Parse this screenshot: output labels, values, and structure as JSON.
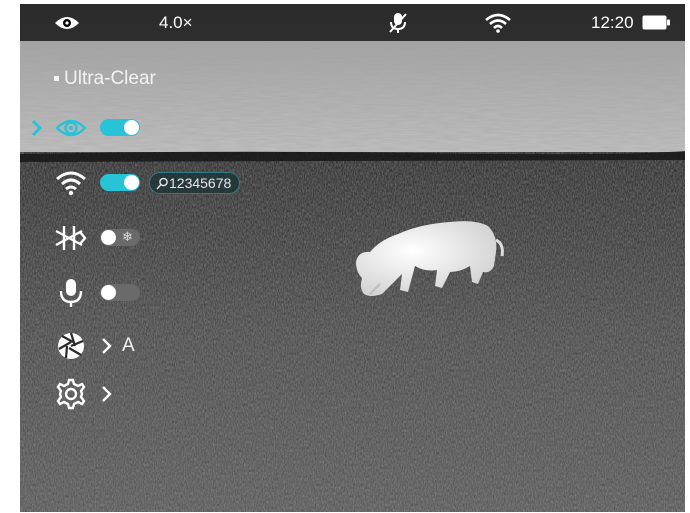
{
  "status_bar": {
    "view_mode_icon": "eye-icon",
    "zoom": "4.0×",
    "mic_icon": "mic-muted-icon",
    "wifi_icon": "wifi-icon",
    "time": "12:20",
    "battery_icon": "battery-icon"
  },
  "menu": {
    "title": "Ultra-Clear",
    "items": [
      {
        "icon": "eye-icon",
        "type": "toggle",
        "state": "on",
        "selected": true
      },
      {
        "icon": "wifi-icon",
        "type": "toggle",
        "state": "on",
        "ssid": "12345678",
        "ssid_icon": "key-icon"
      },
      {
        "icon": "snowflake-icon",
        "type": "toggle",
        "state": "off"
      },
      {
        "icon": "microphone-icon",
        "type": "toggle",
        "state": "off"
      },
      {
        "icon": "aperture-icon",
        "type": "submenu",
        "value": "A"
      },
      {
        "icon": "gear-icon",
        "type": "submenu"
      }
    ]
  },
  "colors": {
    "accent": "#27c3d6",
    "toggle_off": "#6a6a6a",
    "statusbar_bg": "#000000"
  }
}
